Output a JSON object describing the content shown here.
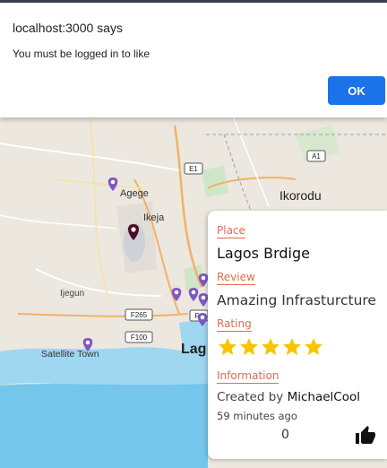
{
  "dialog": {
    "title": "localhost:3000 says",
    "message": "You must be logged in to like",
    "ok_label": "OK"
  },
  "map": {
    "place_labels": {
      "agege": "Agege",
      "ikeja": "Ikeja",
      "ikorodu": "Ikorodu",
      "ijegun": "Ijegun",
      "satellite_town": "Satellite Town",
      "lagos": "Lag"
    },
    "road_shields": {
      "e1": "E1",
      "a1": "A1",
      "f265": "F265",
      "f100": "F100",
      "f_partial": "F"
    },
    "colors": {
      "marker": "#7e57c2",
      "marker_active": "#4a0d24",
      "water": "#9fd6f0",
      "sea": "#74c6ea"
    }
  },
  "popup": {
    "place_label": "Place",
    "place_name": "Lagos Brdige",
    "review_label": "Review",
    "review_text": "Amazing Infrasturcture",
    "rating_label": "Rating",
    "rating": 5,
    "information_label": "Information",
    "created_prefix": "Created by ",
    "created_user": "MichaelCool",
    "time_ago": "59 minutes ago",
    "like_count": "0",
    "star_color": "#f7c500",
    "accent_color": "#e36b4c"
  }
}
